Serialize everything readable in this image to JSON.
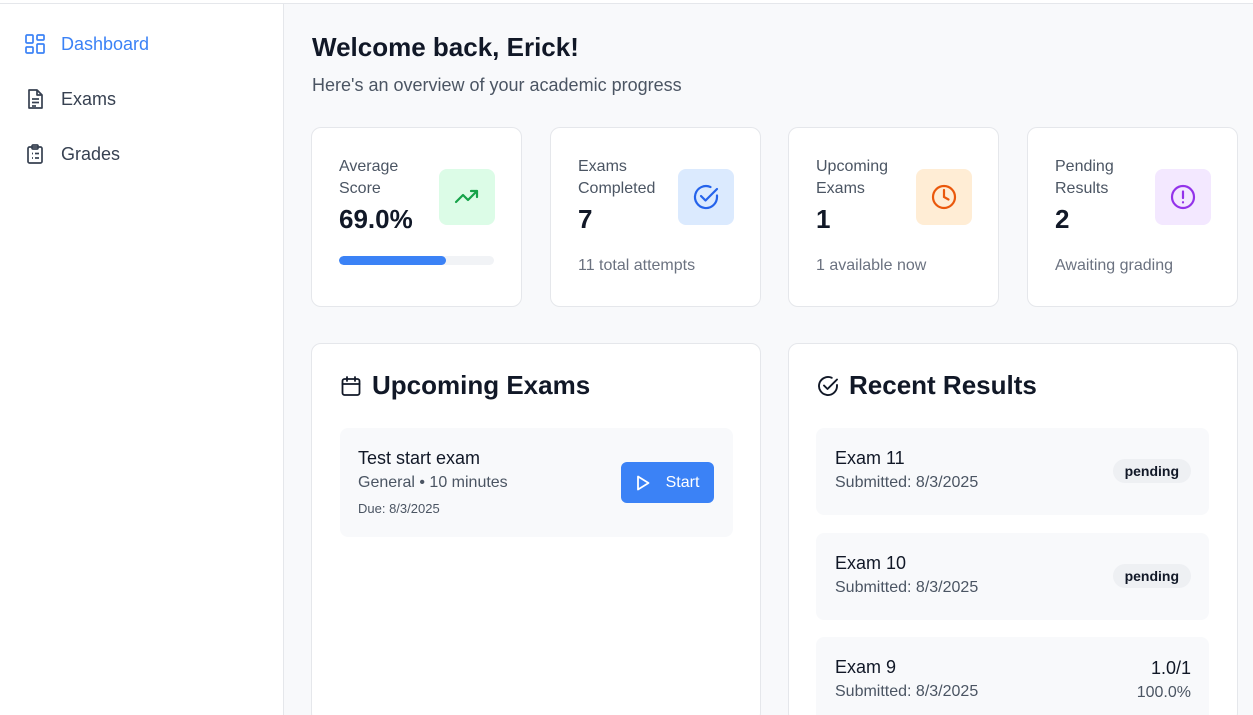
{
  "sidebar": {
    "items": [
      {
        "label": "Dashboard",
        "icon": "dashboard-icon",
        "active": true
      },
      {
        "label": "Exams",
        "icon": "document-icon",
        "active": false
      },
      {
        "label": "Grades",
        "icon": "clipboard-list-icon",
        "active": false
      }
    ]
  },
  "header": {
    "welcome": "Welcome back, Erick!",
    "subtitle": "Here's an overview of your academic progress"
  },
  "stats": [
    {
      "label": "Average Score",
      "value": "69.0%",
      "icon": "trending-up-icon",
      "progress": 0.69,
      "color": "#16a34a",
      "bg": "#dcfce7"
    },
    {
      "label": "Exams Completed",
      "value": "7",
      "note": "11 total attempts",
      "icon": "check-circle-icon",
      "color": "#2563eb",
      "bg": "#dbeafe"
    },
    {
      "label": "Upcoming Exams",
      "value": "1",
      "note": "1 available now",
      "icon": "clock-icon",
      "color": "#ea580c",
      "bg": "#ffedd5"
    },
    {
      "label": "Pending Results",
      "value": "2",
      "note": "Awaiting grading",
      "icon": "alert-circle-icon",
      "color": "#9333ea",
      "bg": "#f3e8ff"
    }
  ],
  "upcoming": {
    "title": "Upcoming Exams",
    "icon": "calendar-icon",
    "items": [
      {
        "name": "Test start exam",
        "meta": "General • 10 minutes",
        "due": "Due: 8/3/2025",
        "button": "Start"
      }
    ]
  },
  "results": {
    "title": "Recent Results",
    "icon": "check-circle-icon",
    "items": [
      {
        "name": "Exam 11",
        "submitted": "Submitted: 8/3/2025",
        "status": "pending"
      },
      {
        "name": "Exam 10",
        "submitted": "Submitted: 8/3/2025",
        "status": "pending"
      },
      {
        "name": "Exam 9",
        "submitted": "Submitted: 8/3/2025",
        "score": "1.0/1",
        "percent": "100.0%"
      }
    ]
  },
  "colors": {
    "accent": "#3b82f6"
  }
}
